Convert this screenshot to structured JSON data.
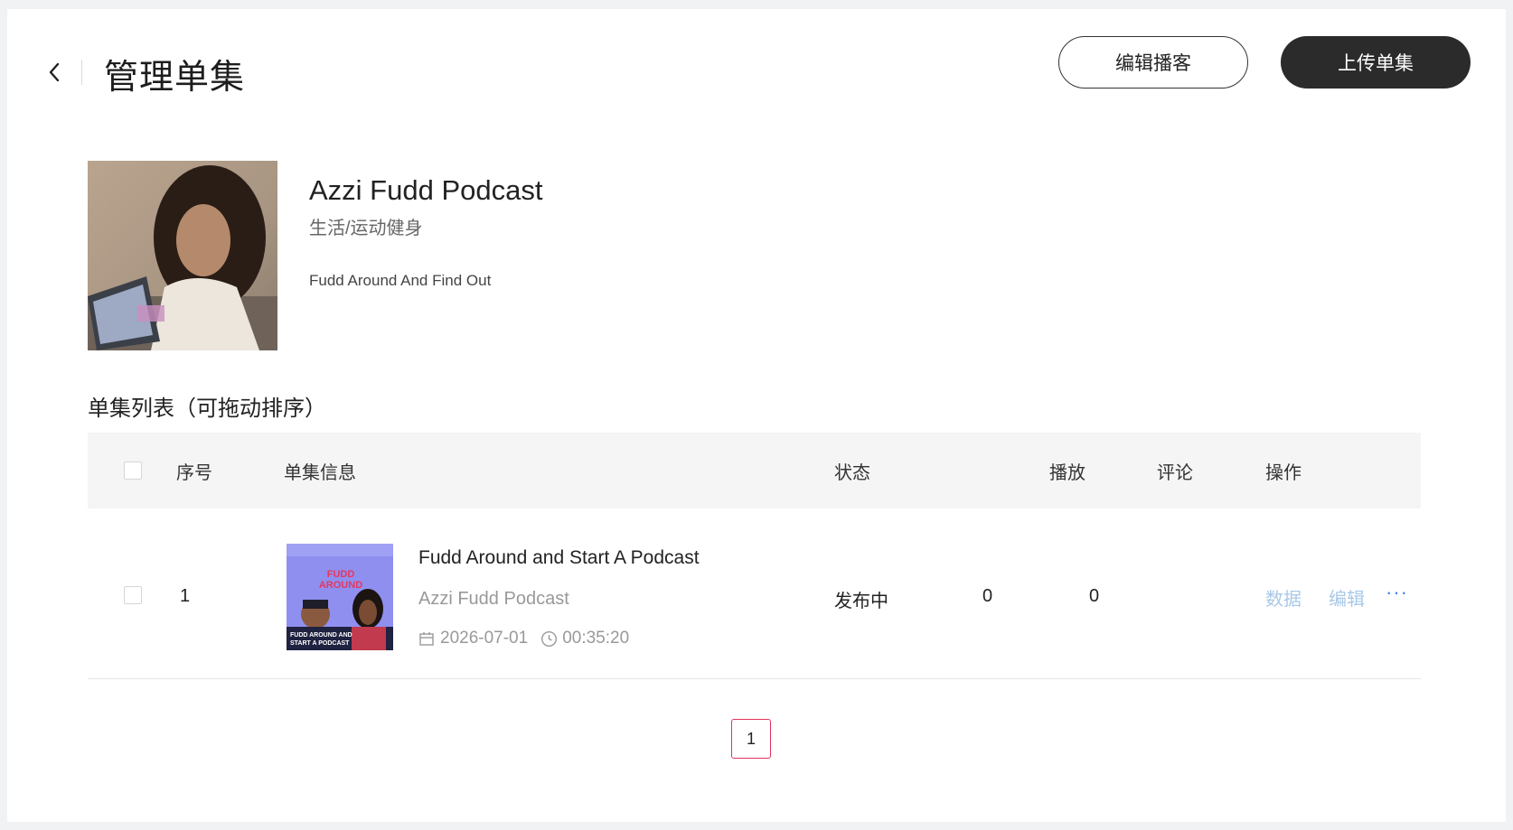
{
  "header": {
    "title": "管理单集",
    "edit_podcast_label": "编辑播客",
    "upload_episode_label": "上传单集"
  },
  "podcast": {
    "title": "Azzi Fudd Podcast",
    "category": "生活/运动健身",
    "description": "Fudd Around And Find Out"
  },
  "episode_list": {
    "title": "单集列表（可拖动排序）",
    "columns": {
      "index": "序号",
      "info": "单集信息",
      "status": "状态",
      "plays": "播放",
      "comments": "评论",
      "actions": "操作"
    },
    "rows": [
      {
        "index": "1",
        "title": "Fudd Around and Start A Podcast",
        "podcast": "Azzi Fudd Podcast",
        "date": "2026-07-01",
        "duration": "00:35:20",
        "status": "发布中",
        "plays": "0",
        "comments": "0",
        "action_data": "数据",
        "action_edit": "编辑",
        "action_more": "···",
        "thumb_text_top": "FUDD AROUND",
        "thumb_text_bottom": "FUDD AROUND AND START A PODCAST"
      }
    ]
  },
  "pagination": {
    "current": "1"
  },
  "colors": {
    "primary_dark": "#2b2b2b",
    "link_muted": "#a9c8e8",
    "link": "#3d7ff0",
    "pager_border": "#e0335a",
    "thumb_bg": "#8f8ff0"
  },
  "icons": [
    "chevron-left-icon",
    "calendar-icon",
    "clock-icon",
    "more-icon"
  ]
}
